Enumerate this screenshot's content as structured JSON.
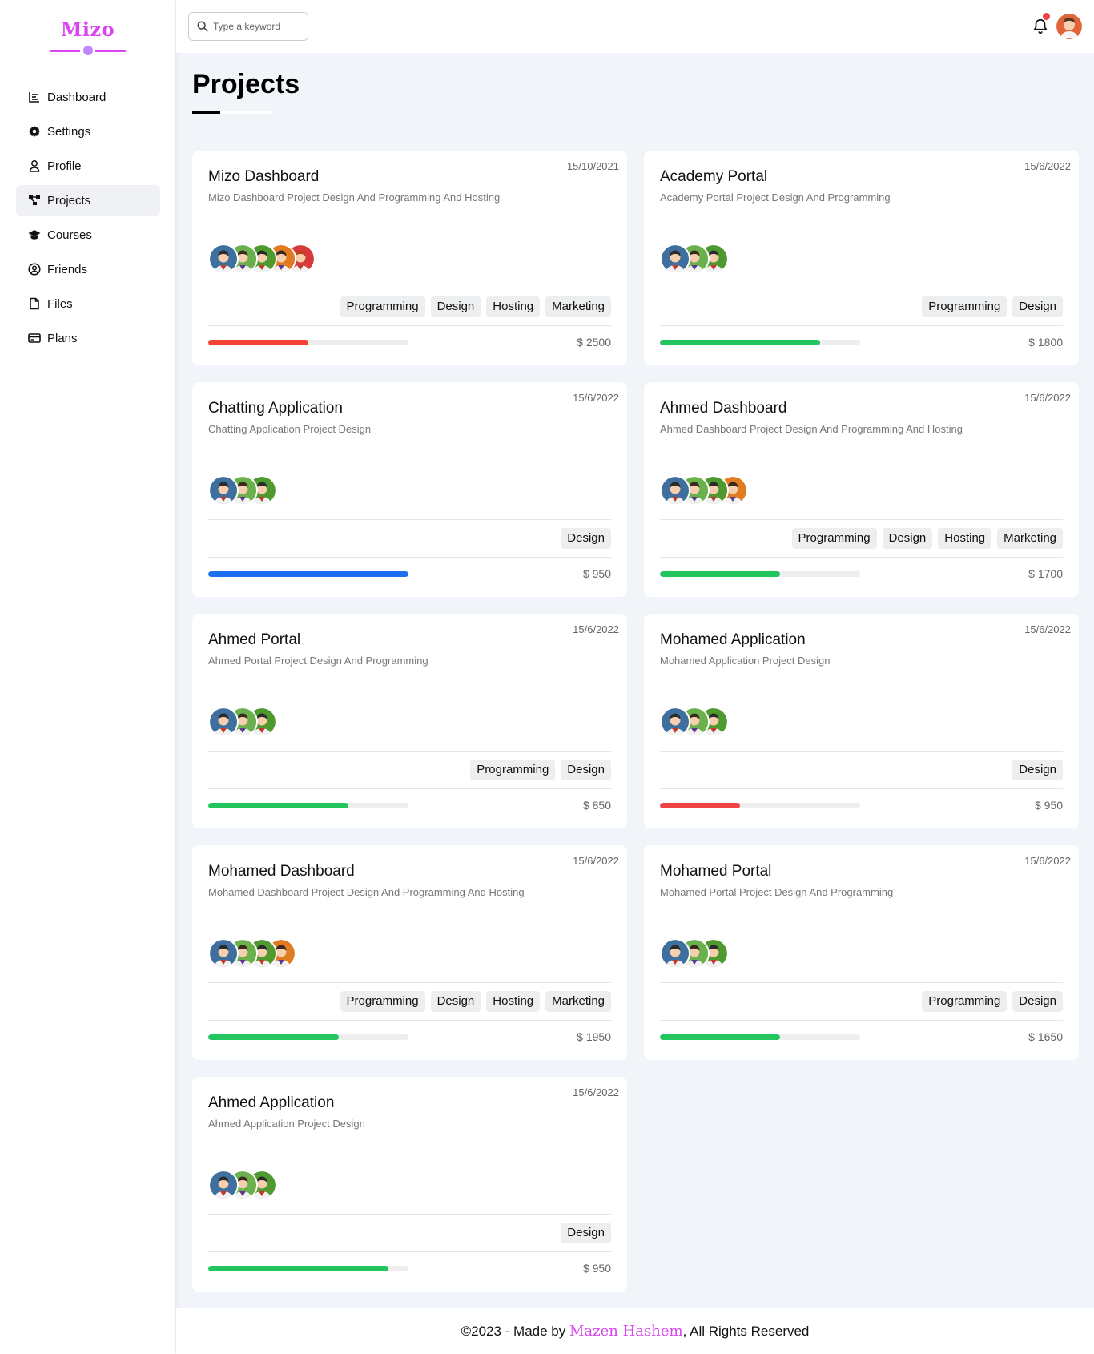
{
  "brand": {
    "logo": "Mizo",
    "accent": "#d946ef"
  },
  "sidebar": {
    "items": [
      {
        "label": "Dashboard",
        "icon": "chart-icon",
        "active": false
      },
      {
        "label": "Settings",
        "icon": "gear-icon",
        "active": false
      },
      {
        "label": "Profile",
        "icon": "user-icon",
        "active": false
      },
      {
        "label": "Projects",
        "icon": "diagram-icon",
        "active": true
      },
      {
        "label": "Courses",
        "icon": "graduation-cap-icon",
        "active": false
      },
      {
        "label": "Friends",
        "icon": "user-circle-icon",
        "active": false
      },
      {
        "label": "Files",
        "icon": "file-icon",
        "active": false
      },
      {
        "label": "Plans",
        "icon": "credit-card-icon",
        "active": false
      }
    ]
  },
  "header": {
    "search_placeholder": "Type a keyword",
    "notification_dot_color": "#ef4444"
  },
  "page": {
    "title": "Projects"
  },
  "projects": [
    {
      "name": "Mizo Dashboard",
      "desc": "Mizo Dashboard Project Design And Programming And Hosting",
      "date": "15/10/2021",
      "team": 5,
      "tags": [
        "Programming",
        "Design",
        "Hosting",
        "Marketing"
      ],
      "progress": 0.5,
      "color": "#f44336",
      "price": "$ 2500"
    },
    {
      "name": "Academy Portal",
      "desc": "Academy Portal Project Design And Programming",
      "date": "15/6/2022",
      "team": 3,
      "tags": [
        "Programming",
        "Design"
      ],
      "progress": 0.8,
      "color": "#22c55e",
      "price": "$ 1800"
    },
    {
      "name": "Chatting Application",
      "desc": "Chatting Application Project Design",
      "date": "15/6/2022",
      "team": 3,
      "tags": [
        "Design"
      ],
      "progress": 1.0,
      "color": "#1d6ff2",
      "price": "$ 950"
    },
    {
      "name": "Ahmed Dashboard",
      "desc": "Ahmed Dashboard Project Design And Programming And Hosting",
      "date": "15/6/2022",
      "team": 4,
      "tags": [
        "Programming",
        "Design",
        "Hosting",
        "Marketing"
      ],
      "progress": 0.6,
      "color": "#22c55e",
      "price": "$ 1700"
    },
    {
      "name": "Ahmed Portal",
      "desc": "Ahmed Portal Project Design And Programming",
      "date": "15/6/2022",
      "team": 3,
      "tags": [
        "Programming",
        "Design"
      ],
      "progress": 0.7,
      "color": "#22c55e",
      "price": "$ 850"
    },
    {
      "name": "Mohamed Application",
      "desc": "Mohamed Application Project Design",
      "date": "15/6/2022",
      "team": 3,
      "tags": [
        "Design"
      ],
      "progress": 0.4,
      "color": "#ef4444",
      "price": "$ 950"
    },
    {
      "name": "Mohamed Dashboard",
      "desc": "Mohamed Dashboard Project Design And Programming And Hosting",
      "date": "15/6/2022",
      "team": 4,
      "tags": [
        "Programming",
        "Design",
        "Hosting",
        "Marketing"
      ],
      "progress": 0.65,
      "color": "#22c55e",
      "price": "$ 1950"
    },
    {
      "name": "Mohamed Portal",
      "desc": "Mohamed Portal Project Design And Programming",
      "date": "15/6/2022",
      "team": 3,
      "tags": [
        "Programming",
        "Design"
      ],
      "progress": 0.6,
      "color": "#22c55e",
      "price": "$ 1650"
    },
    {
      "name": "Ahmed Application",
      "desc": "Ahmed Application Project Design",
      "date": "15/6/2022",
      "team": 3,
      "tags": [
        "Design"
      ],
      "progress": 0.9,
      "color": "#22c55e",
      "price": "$ 950"
    }
  ],
  "footer": {
    "prefix": "©2023 - Made by ",
    "author": "Mazen Hashem",
    "suffix": ", All Rights Reserved"
  }
}
